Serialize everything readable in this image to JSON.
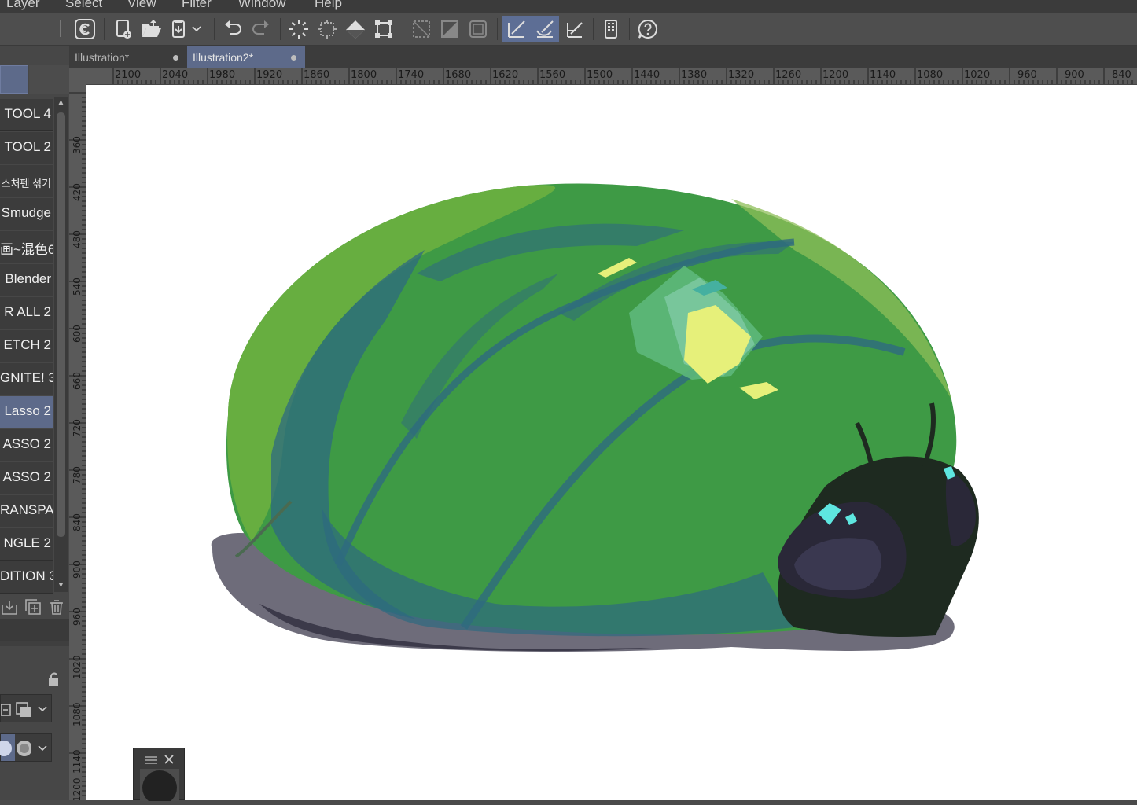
{
  "menu": {
    "items": [
      "Layer",
      "Select",
      "View",
      "Filter",
      "Window",
      "Help"
    ]
  },
  "toolbar": {
    "icons": [
      "clip-studio-icon",
      "new-canvas-icon",
      "open-folder-icon",
      "save-icon",
      "undo-icon",
      "redo-icon",
      "select-all-icon",
      "deselect-icon",
      "fill-icon",
      "transform-icon",
      "show-area-icon",
      "clip-icon",
      "ruler-icon",
      "snap-ruler-icon",
      "snap-special-icon",
      "snap-grid-icon",
      "tablet-icon",
      "help-icon"
    ]
  },
  "tabs": [
    {
      "label": "Illustration*"
    },
    {
      "label": "Illustration2*"
    }
  ],
  "tools": [
    {
      "label": "TOOL 4"
    },
    {
      "label": "TOOL 2"
    },
    {
      "label": "스처펜 섞기"
    },
    {
      "label": "Smudge"
    },
    {
      "label": "画~混色6"
    },
    {
      "label": "Blender"
    },
    {
      "label": "R ALL 2"
    },
    {
      "label": "ETCH 2"
    },
    {
      "label": "GNITE! 3"
    },
    {
      "label": "Lasso 2"
    },
    {
      "label": "ASSO 2"
    },
    {
      "label": "ASSO 2"
    },
    {
      "label": "RANSPA"
    },
    {
      "label": "NGLE 2"
    },
    {
      "label": "DITION 3"
    }
  ],
  "ruler_x": [
    "2100",
    "2040",
    "1980",
    "1920",
    "1860",
    "1800",
    "1740",
    "1680",
    "1620",
    "1560",
    "1500",
    "1440",
    "1380",
    "1320",
    "1260",
    "1200",
    "1140",
    "1080",
    "1020",
    "960",
    "900",
    "840"
  ],
  "ruler_y": [
    "360",
    "420",
    "480",
    "540",
    "600",
    "660",
    "720",
    "780",
    "840",
    "900",
    "960",
    "1020",
    "1080",
    "1140",
    "1200"
  ],
  "colors": {
    "accent": "#5d6a8a",
    "shell_green": "#3e9a45",
    "shell_light": "#6fb23f",
    "shell_blue": "#2e6a80",
    "highlight_yellow": "#e6f07a",
    "shadow": "#6e6c7a",
    "head_dark": "#1e2a20",
    "eye_cyan": "#5ee6e0"
  }
}
